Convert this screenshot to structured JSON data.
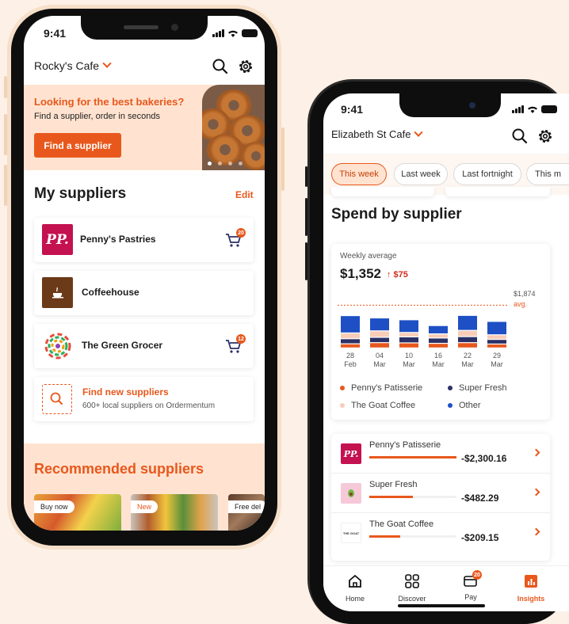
{
  "phone1": {
    "status_time": "9:41",
    "cafe_name": "Rocky's Cafe",
    "banner": {
      "title": "Looking for the best bakeries?",
      "subtitle": "Find a supplier, order in seconds",
      "button": "Find a supplier"
    },
    "my_suppliers_title": "My suppliers",
    "edit_label": "Edit",
    "suppliers": [
      {
        "name": "Penny's Pastries",
        "logo_text": "PP.",
        "cart_badge": "20"
      },
      {
        "name": "Coffeehouse",
        "logo_text": "",
        "cart_badge": ""
      },
      {
        "name": "The Green Grocer",
        "logo_text": "",
        "cart_badge": "12"
      }
    ],
    "find_new": {
      "title": "Find new suppliers",
      "subtitle": "600+ local suppliers on Ordermentum"
    },
    "recommended_title": "Recommended suppliers",
    "recommended_tags": [
      "Buy now",
      "New",
      "Free del"
    ]
  },
  "phone2": {
    "status_time": "9:41",
    "cafe_name": "Elizabeth St Cafe",
    "chips": [
      "This week",
      "Last week",
      "Last fortnight",
      "This m"
    ],
    "spend_title": "Spend by supplier",
    "weekly_average_label": "Weekly average",
    "weekly_average_value": "$1,352",
    "change_value": "↑ $75",
    "avg_line_value": "$1,874",
    "avg_line_label": "avg.",
    "legend": [
      "Penny's Patisserie",
      "Super Fresh",
      "The Goat Coffee",
      "Other"
    ],
    "list": [
      {
        "name": "Penny's Patisserie",
        "amount": "-$2,300.16",
        "share": 1.0,
        "logo_text": "PP."
      },
      {
        "name": "Super Fresh",
        "amount": "-$482.29",
        "share": 0.5,
        "logo_text": ""
      },
      {
        "name": "The Goat Coffee",
        "amount": "-$209.15",
        "share": 0.35,
        "logo_text": "THE GOAT"
      }
    ],
    "tabs": [
      {
        "label": "Home",
        "icon": "home-icon"
      },
      {
        "label": "Discover",
        "icon": "grid-icon"
      },
      {
        "label": "Pay",
        "icon": "card-icon",
        "badge": "20"
      },
      {
        "label": "Insights",
        "icon": "bar-chart-icon"
      }
    ]
  },
  "colors": {
    "accent": "#e8581d",
    "peach": "#ffe3d0",
    "navy": "#1e4fc4",
    "dark_navy": "#2c3066",
    "background": "#fdf0e6"
  },
  "chart_data": {
    "type": "bar",
    "categories": [
      "28\nFeb",
      "04\nMar",
      "10\nMar",
      "16\nMar",
      "22\nMar",
      "29\nMar"
    ],
    "category_days": [
      "28",
      "04",
      "10",
      "16",
      "22",
      "29"
    ],
    "category_months": [
      "Feb",
      "Mar",
      "Mar",
      "Mar",
      "Mar",
      "Mar"
    ],
    "series": [
      {
        "name": "Penny's Patisserie",
        "color": "#e8581d",
        "values": [
          180,
          230,
          220,
          200,
          230,
          170
        ]
      },
      {
        "name": "Super Fresh",
        "color": "#2c3066",
        "values": [
          220,
          230,
          260,
          230,
          260,
          200
        ]
      },
      {
        "name": "The Goat Coffee",
        "color": "#f9cdb8",
        "values": [
          250,
          280,
          190,
          180,
          270,
          200
        ]
      },
      {
        "name": "Other",
        "color": "#1e4fc4",
        "values": [
          750,
          560,
          550,
          360,
          650,
          580
        ]
      }
    ],
    "reference_line": {
      "value": 1874,
      "label": "avg."
    },
    "ylim": [
      0,
      2400
    ]
  }
}
